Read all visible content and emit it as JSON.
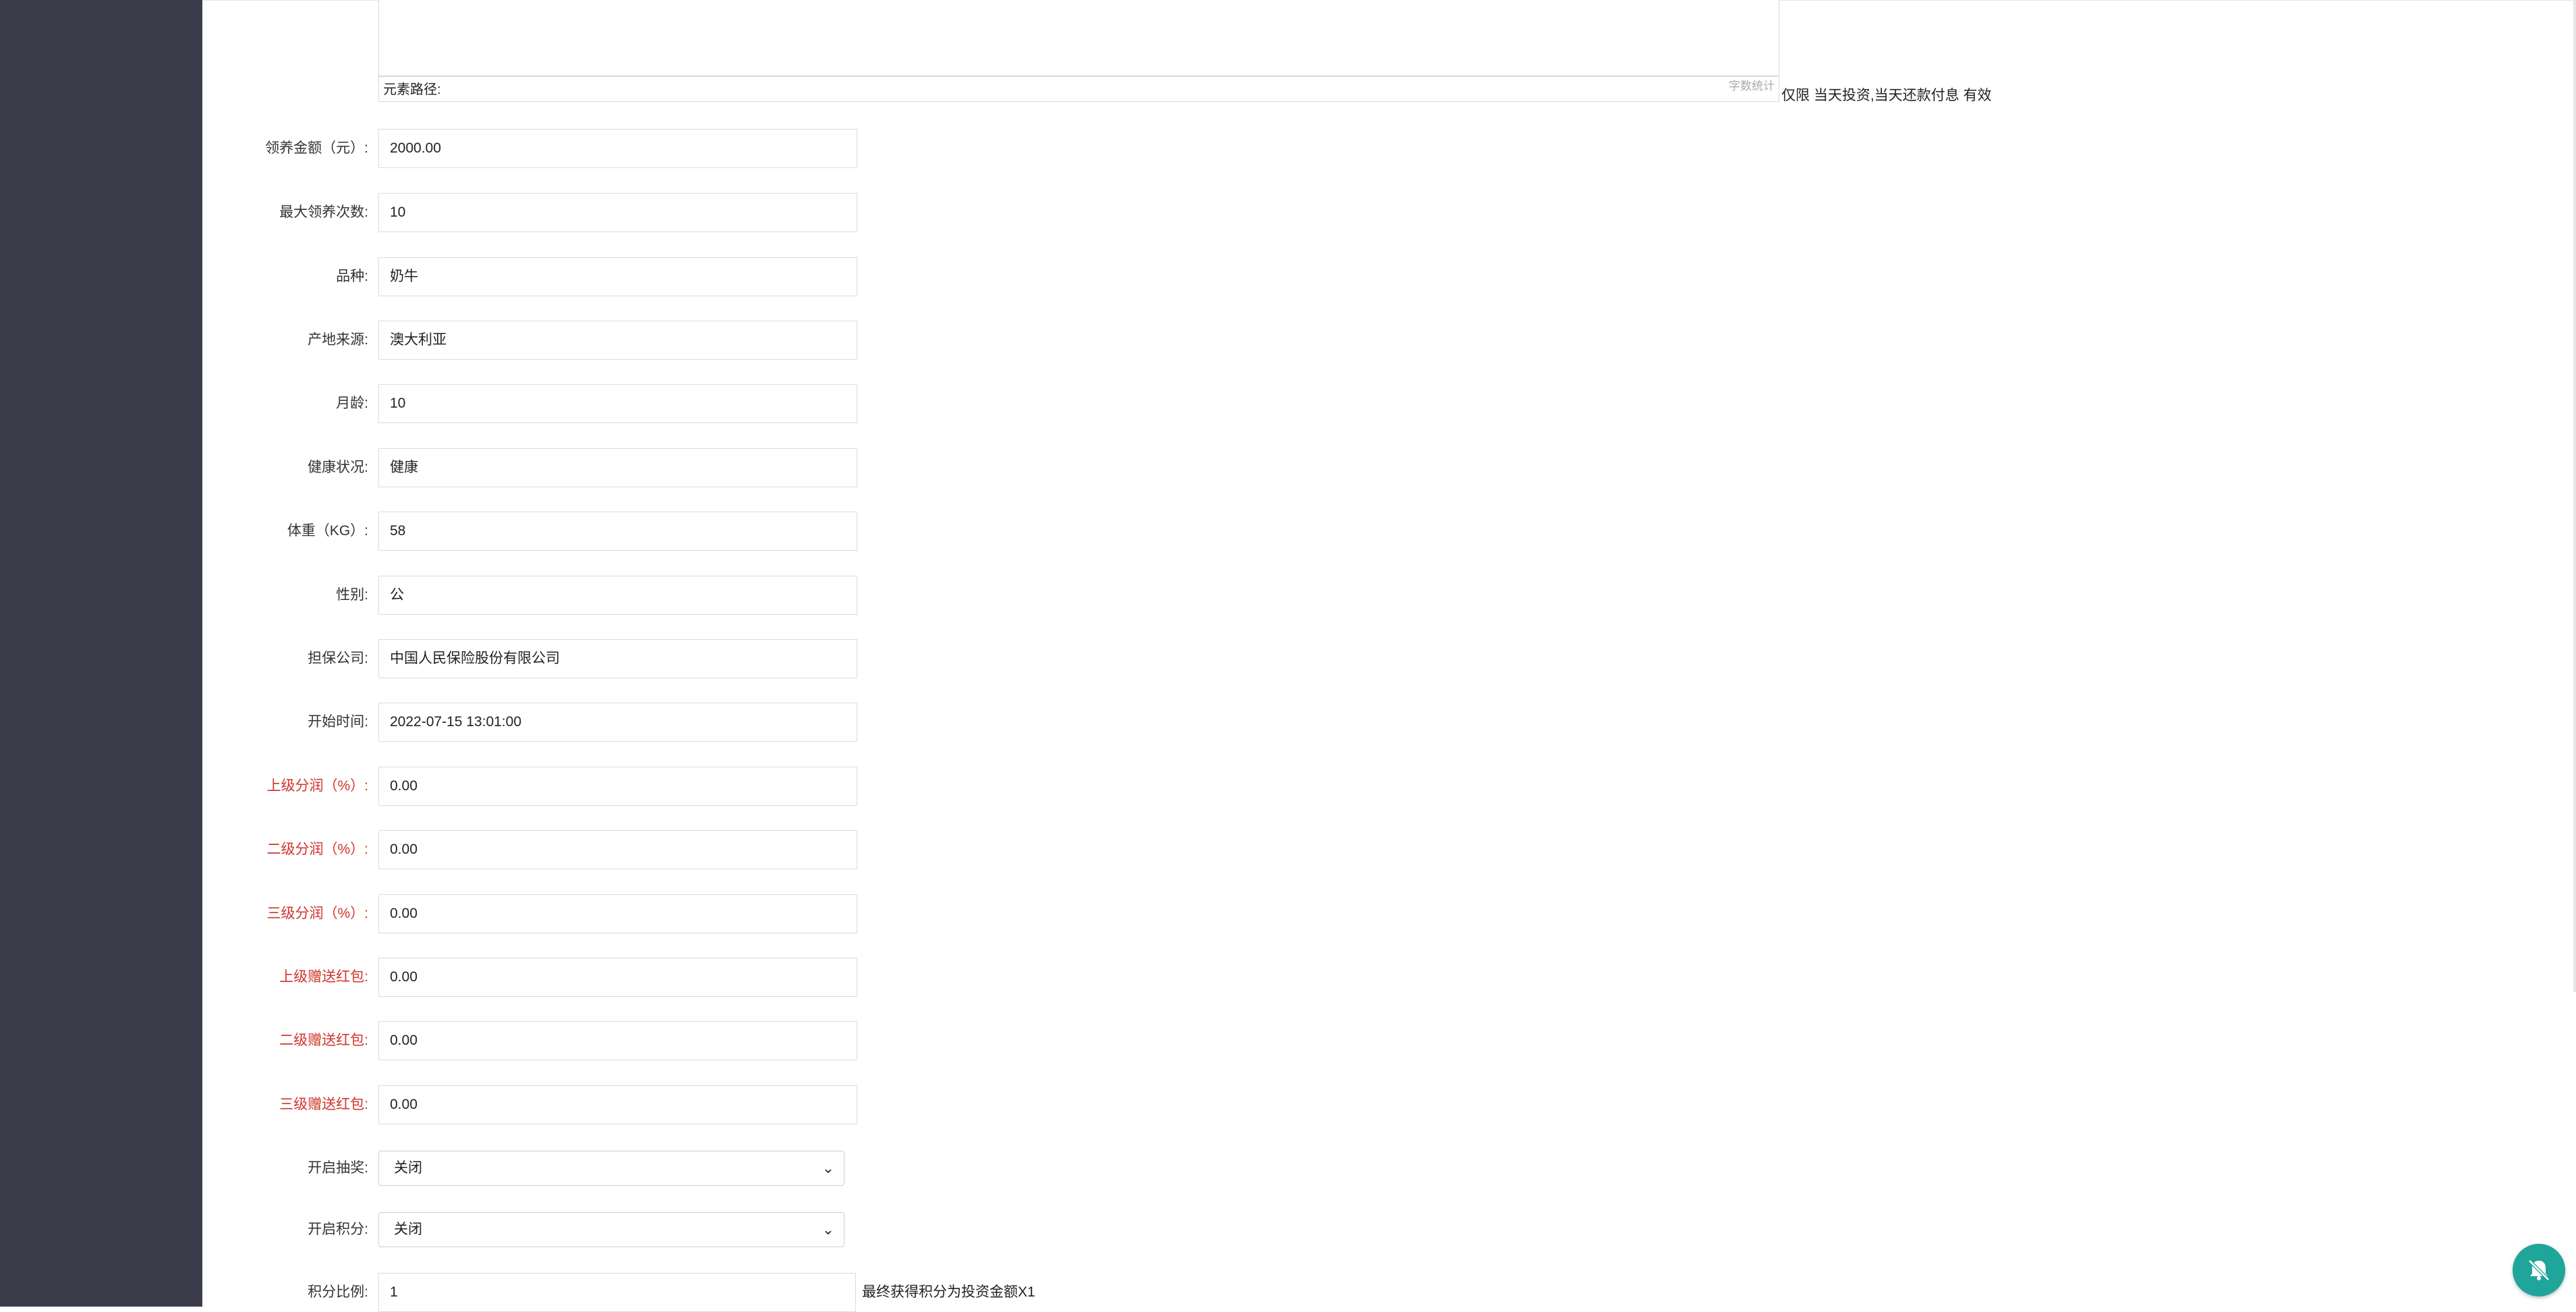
{
  "editor": {
    "path_label": "元素路径:",
    "word_count": "字数统计",
    "hint": "仅限 当天投资,当天还款付息 有效"
  },
  "form": {
    "amount": {
      "label": "领养金额（元）:",
      "value": "2000.00"
    },
    "max_times": {
      "label": "最大领养次数:",
      "value": "10"
    },
    "breed": {
      "label": "品种:",
      "value": "奶牛"
    },
    "origin": {
      "label": "产地来源:",
      "value": "澳大利亚"
    },
    "age_months": {
      "label": "月龄:",
      "value": "10"
    },
    "health": {
      "label": "健康状况:",
      "value": "健康"
    },
    "weight": {
      "label": "体重（KG）:",
      "value": "58"
    },
    "gender": {
      "label": "性别:",
      "value": "公"
    },
    "guarantor": {
      "label": "担保公司:",
      "value": "中国人民保险股份有限公司"
    },
    "start_time": {
      "label": "开始时间:",
      "value": "2022-07-15 13:01:00"
    },
    "level1_share": {
      "label": "上级分润（%）:",
      "value": "0.00"
    },
    "level2_share": {
      "label": "二级分润（%）:",
      "value": "0.00"
    },
    "level3_share": {
      "label": "三级分润（%）:",
      "value": "0.00"
    },
    "level1_bonus": {
      "label": "上级赠送红包:",
      "value": "0.00"
    },
    "level2_bonus": {
      "label": "二级赠送红包:",
      "value": "0.00"
    },
    "level3_bonus": {
      "label": "三级赠送红包:",
      "value": "0.00"
    },
    "lottery": {
      "label": "开启抽奖:",
      "selected": "关闭"
    },
    "points": {
      "label": "开启积分:",
      "selected": "关闭"
    },
    "points_ratio": {
      "label": "积分比例:",
      "value": "1",
      "note": "最终获得积分为投资金额X1"
    }
  },
  "colors": {
    "sidebar": "#3b3d4a",
    "required_label": "#d0342c",
    "fab": "#1fa59a"
  },
  "icons": {
    "fab": "no-bell-icon"
  }
}
